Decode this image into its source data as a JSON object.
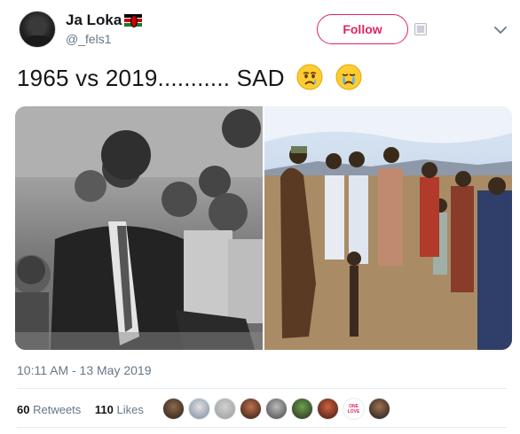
{
  "user": {
    "display_name": "Ja Loka",
    "handle": "@_fels1",
    "flag": "kenya-flag-emoji"
  },
  "actions": {
    "follow_label": "Follow"
  },
  "tweet": {
    "text": "1965 vs 2019........... SAD",
    "emojis": [
      "crying-face-emoji",
      "crying-face-emoji"
    ],
    "timestamp": "10:11 AM - 13 May 2019"
  },
  "stats": {
    "retweets_count": "60",
    "retweets_label": "Retweets",
    "likes_count": "110",
    "likes_label": "Likes"
  },
  "likers": {
    "badge_text_top": "ONE",
    "badge_text_bottom": "LOVE"
  },
  "colors": {
    "follow_accent": "#e0245e",
    "text_primary": "#14171a",
    "text_secondary": "#657786",
    "divider": "#e6ecf0"
  }
}
